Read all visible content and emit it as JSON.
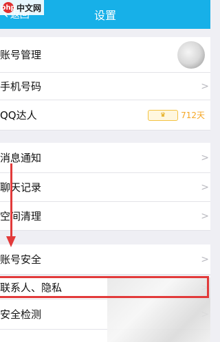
{
  "header": {
    "back_label": "返回",
    "title": "设置",
    "bg_color": "#17b0e8"
  },
  "watermark": {
    "logo": "php",
    "text": "中文网"
  },
  "rows": [
    {
      "label": "账号管理",
      "right": "avatar"
    },
    {
      "label": "手机号码"
    },
    {
      "label": "QQ达人",
      "badge_icon": "crown-icon",
      "badge_days": "712天"
    },
    {
      "label": "消息通知"
    },
    {
      "label": "聊天记录"
    },
    {
      "label": "空间清理"
    },
    {
      "label": "账号安全"
    },
    {
      "label": "联系人、隐私"
    },
    {
      "label": "安全检测"
    }
  ],
  "chevron": ">",
  "annotation_color": "#e23a3a"
}
